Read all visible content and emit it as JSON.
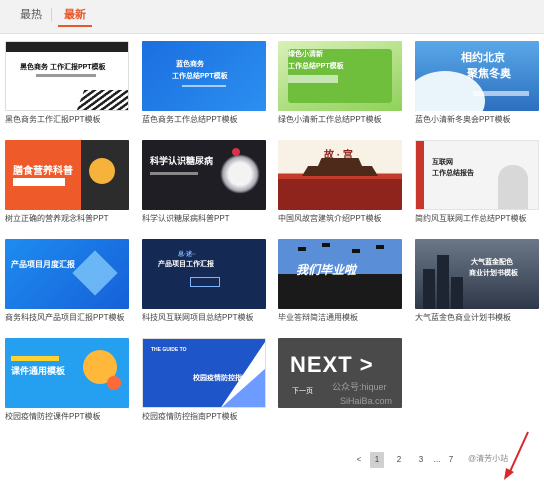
{
  "tabs": [
    {
      "label": "最热"
    },
    {
      "label": "最新"
    }
  ],
  "cards": [
    {
      "title": "黑色商务工作汇报PPT模板",
      "thumb_text": [
        "黑色商务 工作汇报PPT模板"
      ]
    },
    {
      "title": "蓝色商务工作总结PPT模板",
      "thumb_text": [
        "蓝色商务",
        "工作总结PPT模板"
      ]
    },
    {
      "title": "绿色小清新工作总结PPT模板",
      "thumb_text": [
        "绿色小清新",
        "工作总结PPT模板"
      ]
    },
    {
      "title": "蓝色小清新冬奥会PPT模板",
      "thumb_text": [
        "相约北京",
        "聚焦冬奥"
      ]
    },
    {
      "title": "树立正确的营养观念科普PPT",
      "thumb_text": [
        "膳食营养科普"
      ]
    },
    {
      "title": "科学认识糖尿病科普PPT",
      "thumb_text": [
        "科学认识糖尿病"
      ]
    },
    {
      "title": "中国风故宫建筑介绍PPT模板",
      "thumb_text": [
        "故 · 宫"
      ]
    },
    {
      "title": "简约风互联网工作总结PPT模板",
      "thumb_text": [
        "互联网",
        "工作总结报告"
      ]
    },
    {
      "title": "商务科技风产品项目汇报PPT模板",
      "thumb_text": [
        "产品项目月度汇报"
      ]
    },
    {
      "title": "科技风互联网项目总结PPT模板",
      "thumb_text": [
        "总·述··",
        "产品项目工作汇报"
      ]
    },
    {
      "title": "毕业答辩简洁通用模板",
      "thumb_text": [
        "我们毕业啦"
      ]
    },
    {
      "title": "大气蓝金色商业计划书模板",
      "thumb_text": [
        "大气蓝金配色",
        "商业计划书模板"
      ]
    },
    {
      "title": "校园疫情防控课件PPT模板",
      "thumb_text": [
        "课件通用模板"
      ]
    },
    {
      "title": "校园疫情防控指南PPT模板",
      "thumb_text": [
        "THE GUIDE TO",
        "校园疫情防控指南"
      ]
    },
    {
      "title": "",
      "thumb_text": [
        "NEXT >",
        "下一页"
      ]
    }
  ],
  "watermark": {
    "line1": "公众号:hiquer",
    "line2": "SiHaiBa.com"
  },
  "pagination": {
    "prev_glyph": "<",
    "pages": [
      "1",
      "2",
      "3"
    ],
    "ellipsis": "...",
    "last": "7",
    "active": "1",
    "watermark_text": "@清芳小站"
  }
}
